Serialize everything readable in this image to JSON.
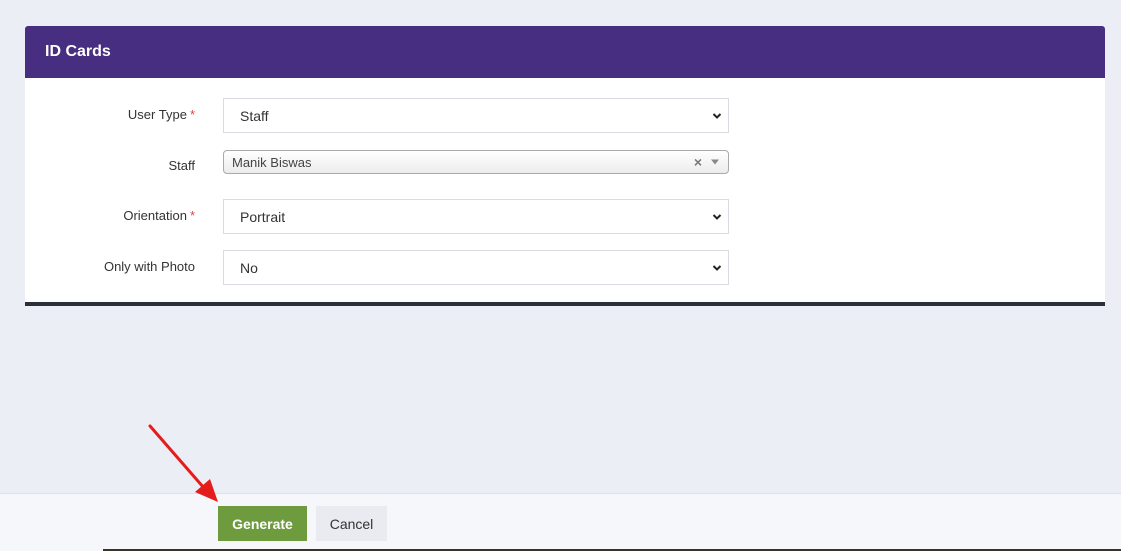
{
  "panel": {
    "title": "ID Cards"
  },
  "form": {
    "user_type": {
      "label": "User Type",
      "required_mark": "*",
      "value": "Staff"
    },
    "staff": {
      "label": "Staff",
      "value": "Manik Biswas",
      "clear_symbol": "×"
    },
    "orientation": {
      "label": "Orientation",
      "required_mark": "*",
      "value": "Portrait"
    },
    "only_with_photo": {
      "label": "Only with Photo",
      "value": "No"
    }
  },
  "footer": {
    "generate_label": "Generate",
    "cancel_label": "Cancel"
  },
  "colors": {
    "header_bg": "#482e80",
    "generate_bg": "#6e9b3e",
    "required": "#e04545",
    "annotation_arrow": "#e51c1c"
  }
}
